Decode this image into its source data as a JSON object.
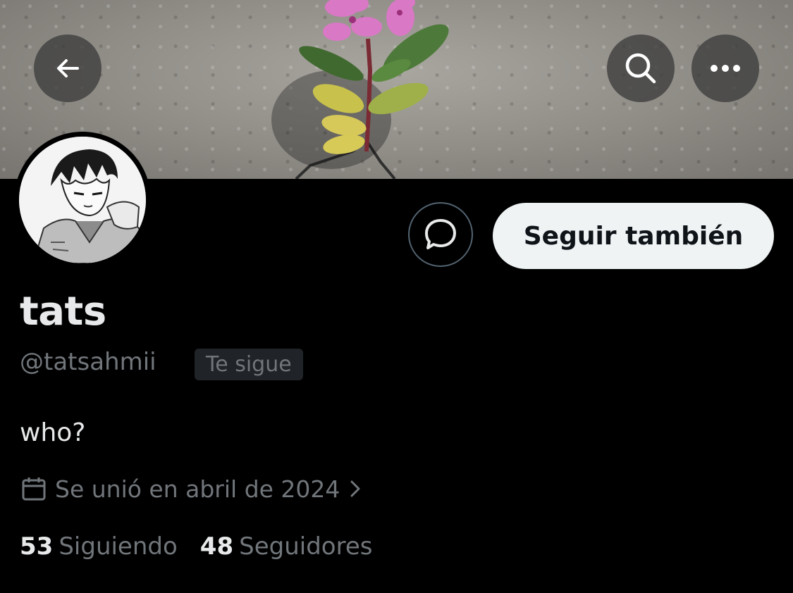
{
  "header": {
    "back_icon": "arrow-left-icon",
    "search_icon": "search-icon",
    "more_icon": "more-horizontal-icon"
  },
  "profile": {
    "display_name": "tats",
    "handle": "@tatsahmii",
    "follows_you_badge": "Te sigue",
    "bio": "who?",
    "joined": "Se unió en abril de 2024",
    "following_count": "53",
    "following_label": "Siguiendo",
    "followers_count": "48",
    "followers_label": "Seguidores"
  },
  "actions": {
    "message_icon": "message-icon",
    "follow_back_label": "Seguir también"
  },
  "colors": {
    "background": "#000000",
    "primary_text": "#e7e9ea",
    "secondary_text": "#71767b",
    "button_bg": "#eff3f4",
    "badge_bg": "#202327"
  }
}
